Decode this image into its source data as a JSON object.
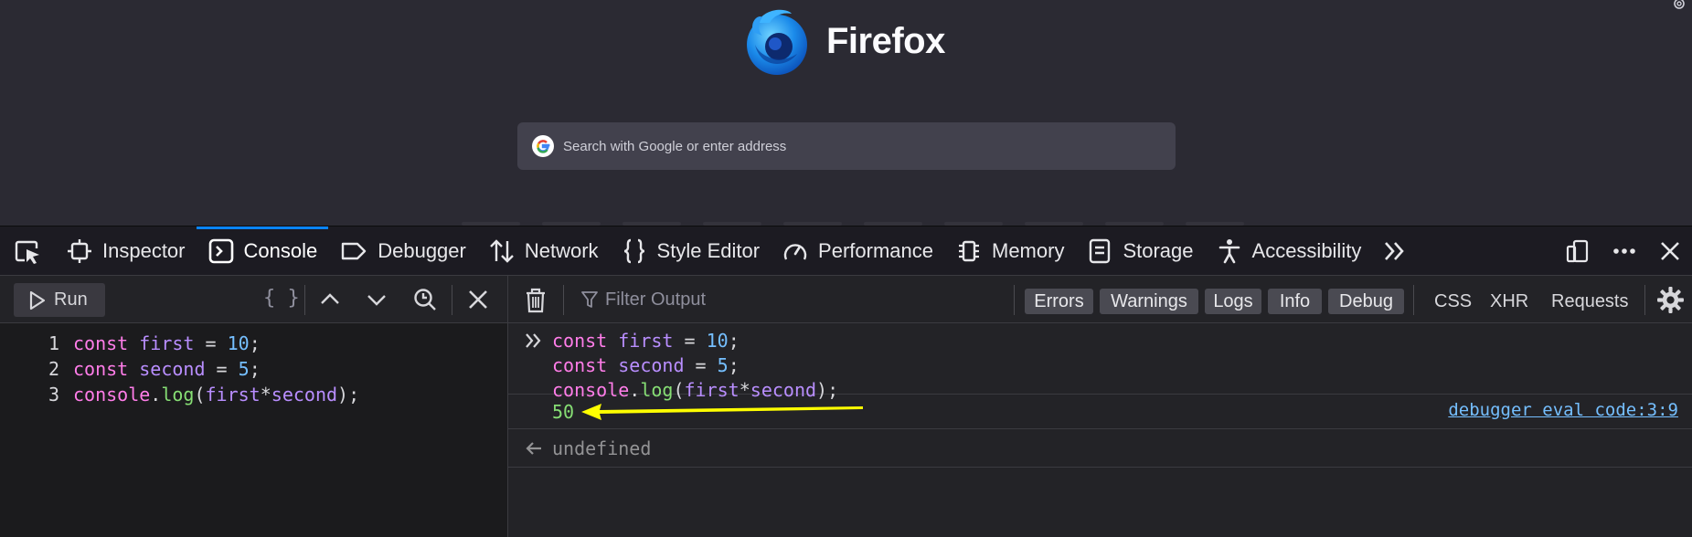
{
  "newtab": {
    "brand_name": "Firefox",
    "search_placeholder": "Search with Google or enter address"
  },
  "devtools": {
    "tabs": [
      {
        "label": "Inspector",
        "icon": "inspector-icon",
        "active": false
      },
      {
        "label": "Console",
        "icon": "console-icon",
        "active": true
      },
      {
        "label": "Debugger",
        "icon": "debugger-icon",
        "active": false
      },
      {
        "label": "Network",
        "icon": "network-icon",
        "active": false
      },
      {
        "label": "Style Editor",
        "icon": "style-editor-icon",
        "active": false
      },
      {
        "label": "Performance",
        "icon": "performance-icon",
        "active": false
      },
      {
        "label": "Memory",
        "icon": "memory-icon",
        "active": false
      },
      {
        "label": "Storage",
        "icon": "storage-icon",
        "active": false
      },
      {
        "label": "Accessibility",
        "icon": "accessibility-icon",
        "active": false
      }
    ],
    "editor": {
      "run_label": "Run",
      "pretty_print_label": "{ }",
      "line_numbers": [
        "1",
        "2",
        "3"
      ]
    },
    "output": {
      "filter_placeholder": "Filter Output",
      "levels": [
        "Errors",
        "Warnings",
        "Logs",
        "Info",
        "Debug"
      ],
      "network_filters": [
        "CSS",
        "XHR",
        "Requests"
      ],
      "result_value": "50",
      "source_link": "debugger eval code:3:9",
      "return_value": "undefined"
    },
    "code": [
      [
        {
          "t": "const",
          "c": "kw"
        },
        {
          "t": " ",
          "c": "pl"
        },
        {
          "t": "first",
          "c": "var"
        },
        {
          "t": " = ",
          "c": "pl"
        },
        {
          "t": "10",
          "c": "num"
        },
        {
          "t": ";",
          "c": "pl"
        }
      ],
      [
        {
          "t": "const",
          "c": "kw"
        },
        {
          "t": " ",
          "c": "pl"
        },
        {
          "t": "second",
          "c": "var"
        },
        {
          "t": " = ",
          "c": "pl"
        },
        {
          "t": "5",
          "c": "num"
        },
        {
          "t": ";",
          "c": "pl"
        }
      ],
      [
        {
          "t": "console",
          "c": "obj"
        },
        {
          "t": ".",
          "c": "pl"
        },
        {
          "t": "log",
          "c": "fn"
        },
        {
          "t": "(",
          "c": "pl"
        },
        {
          "t": "first",
          "c": "var"
        },
        {
          "t": "*",
          "c": "pl"
        },
        {
          "t": "second",
          "c": "var"
        },
        {
          "t": ");",
          "c": "pl"
        }
      ]
    ],
    "colors": {
      "accent": "#0a84ff",
      "keyword": "#ff7de9",
      "variable": "#b98eff",
      "number": "#75bfff",
      "function": "#86de74",
      "annotation_arrow": "#ffff00"
    }
  }
}
